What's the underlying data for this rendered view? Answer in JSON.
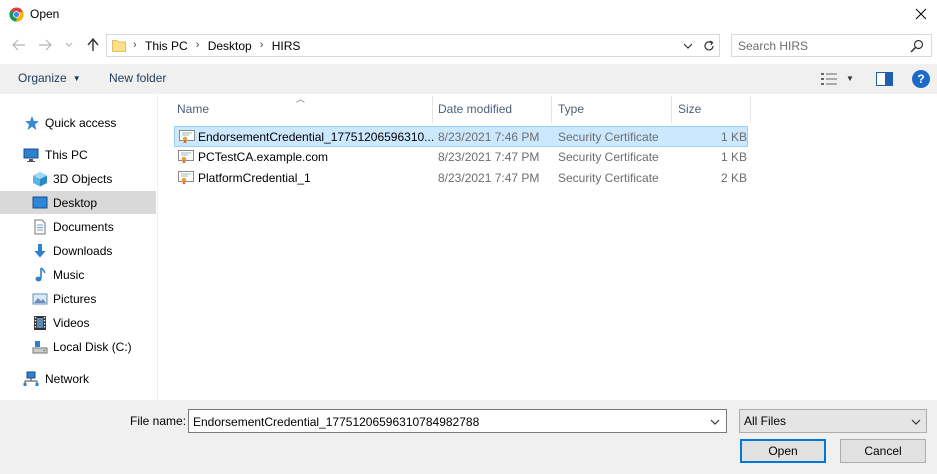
{
  "window": {
    "title": "Open"
  },
  "address": {
    "crumbs": [
      "This PC",
      "Desktop",
      "HIRS"
    ]
  },
  "search": {
    "placeholder": "Search HIRS"
  },
  "toolbar": {
    "organize_label": "Organize",
    "new_folder_label": "New folder"
  },
  "nav": {
    "quick_access": "Quick access",
    "this_pc": "This PC",
    "objects_3d": "3D Objects",
    "desktop": "Desktop",
    "documents": "Documents",
    "downloads": "Downloads",
    "music": "Music",
    "pictures": "Pictures",
    "videos": "Videos",
    "local_disk": "Local Disk (C:)",
    "network": "Network"
  },
  "columns": {
    "name": "Name",
    "date_modified": "Date modified",
    "type": "Type",
    "size": "Size"
  },
  "files": [
    {
      "name": "EndorsementCredential_17751206596310...",
      "date": "8/23/2021 7:46 PM",
      "type": "Security Certificate",
      "size": "1 KB",
      "selected": true
    },
    {
      "name": "PCTestCA.example.com",
      "date": "8/23/2021 7:47 PM",
      "type": "Security Certificate",
      "size": "1 KB",
      "selected": false
    },
    {
      "name": "PlatformCredential_1",
      "date": "8/23/2021 7:47 PM",
      "type": "Security Certificate",
      "size": "2 KB",
      "selected": false
    }
  ],
  "bottom": {
    "file_name_label": "File name:",
    "file_name_value": "EndorsementCredential_177512065963107849827​88",
    "file_type_value": "All Files",
    "open_label": "Open",
    "cancel_label": "Cancel"
  },
  "colors": {
    "selection": "#cce8ff",
    "selection_border": "#99d1ff",
    "accent": "#0078d7",
    "toolbar_bg": "#f0f0f0"
  }
}
